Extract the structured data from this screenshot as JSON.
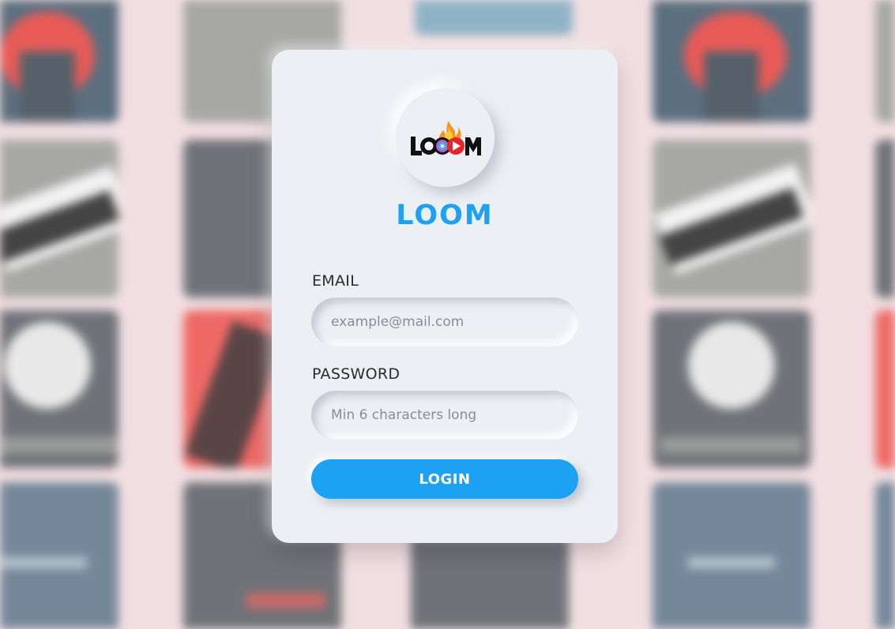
{
  "brand": {
    "name": "LOOM",
    "logo_text": "LOOM",
    "accent_color": "#1da1f2"
  },
  "form": {
    "email_label": "EMAIL",
    "email_placeholder": "example@mail.com",
    "email_value": "",
    "password_label": "PASSWORD",
    "password_placeholder": "Min 6 characters long",
    "password_value": "",
    "submit_label": "LOGIN"
  },
  "background": {
    "description_icons": [
      "poster-thumbnails"
    ]
  }
}
